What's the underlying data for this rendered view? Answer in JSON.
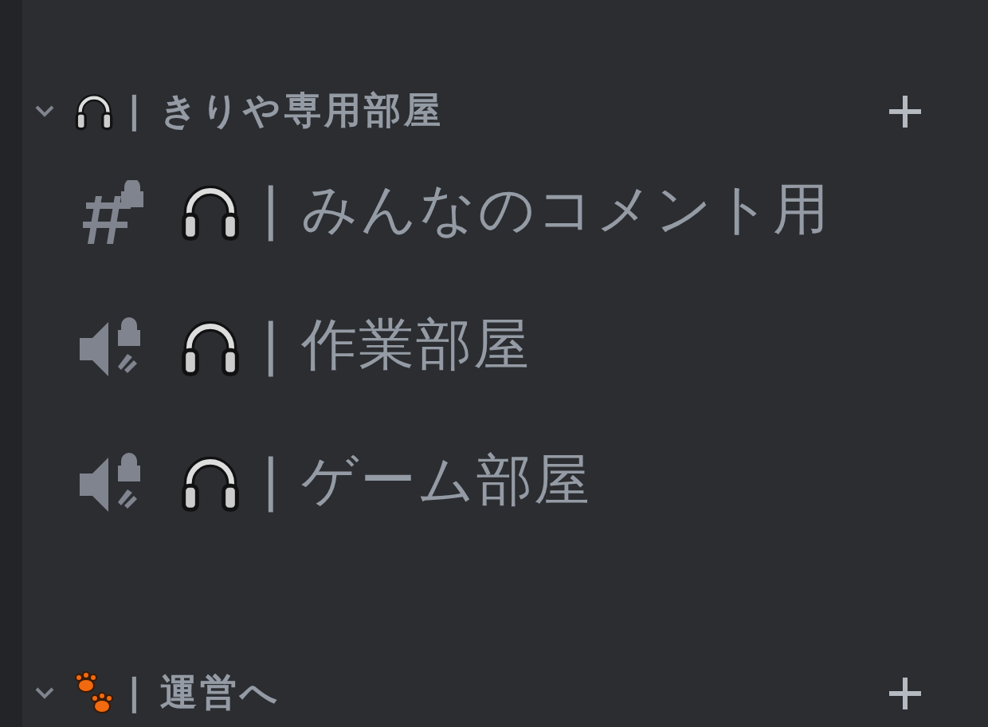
{
  "categories": [
    {
      "kind": "headphones",
      "name": "| きりや専用部屋",
      "expanded": true,
      "channels": [
        {
          "kind": "text-locked",
          "name": "| みんなのコメント用"
        },
        {
          "kind": "voice-locked",
          "name": "| 作業部屋"
        },
        {
          "kind": "voice-locked",
          "name": "| ゲーム部屋"
        }
      ]
    },
    {
      "kind": "paws",
      "name": "| 運営へ",
      "expanded": true
    }
  ]
}
